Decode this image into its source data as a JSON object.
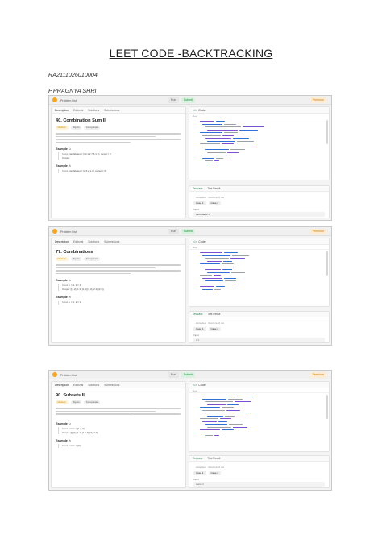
{
  "document": {
    "title": "LEET CODE -BACKTRACKING",
    "register_number": "RA2111026010004",
    "student_name": "P.PRAGNYA SHRI"
  },
  "screenshots": [
    {
      "problem_title": "40. Combination Sum II",
      "difficulty": "Medium",
      "tags": [
        "Topics",
        "Companies"
      ],
      "tabs": [
        "Description",
        "Editorial",
        "Solutions",
        "Submissions"
      ],
      "example_heading": "Example 1:",
      "example_input": "Input: candidates = [10,1,2,7,6,1,5], target = 8",
      "example_output": "Output:",
      "example2_heading": "Example 2:",
      "example2_input": "Input: candidates = [2,5,2,1,2], target = 5",
      "result": "Accepted",
      "runtime": "Runtime: 0 ms",
      "cases": [
        "Case 1",
        "Case 2"
      ],
      "input_label": "Input",
      "input_value": "candidates ="
    },
    {
      "problem_title": "77. Combinations",
      "difficulty": "Medium",
      "tags": [
        "Topics",
        "Companies"
      ],
      "tabs": [
        "Description",
        "Editorial",
        "Solutions",
        "Submissions"
      ],
      "example_heading": "Example 1:",
      "example_input": "Input: n = 4, k = 2",
      "example_output": "Output: [[1,2],[1,3],[1,4],[2,3],[2,4],[3,4]]",
      "example2_heading": "Example 2:",
      "example2_input": "Input: n = 1, k = 1",
      "result": "Accepted",
      "runtime": "Runtime: 0 ms",
      "cases": [
        "Case 1",
        "Case 2"
      ],
      "input_label": "Input",
      "input_value": "n ="
    },
    {
      "problem_title": "90. Subsets II",
      "difficulty": "Medium",
      "tags": [
        "Topics",
        "Companies"
      ],
      "tabs": [
        "Description",
        "Editorial",
        "Solutions",
        "Submissions"
      ],
      "example_heading": "Example 1:",
      "example_input": "Input: nums = [1,2,2]",
      "example_output": "Output: [[],[1],[1,2],[1,2,2],[2],[2,2]]",
      "example2_heading": "Example 2:",
      "example2_input": "Input: nums = [0]",
      "result": "Accepted",
      "runtime": "Runtime: 0 ms",
      "cases": [
        "Case 1",
        "Case 2"
      ],
      "input_label": "Input",
      "input_value": "nums ="
    }
  ],
  "toolbar": {
    "problem_list": "Problem List",
    "run": "Run",
    "submit": "Submit",
    "premium": "Premium"
  },
  "editor": {
    "header": "Code",
    "language": "C++",
    "auto": "Auto"
  },
  "result_tabs": {
    "testcase": "Testcase",
    "test_result": "Test Result"
  },
  "colors": {
    "accepted": "#2e8b57",
    "difficulty": "#c98a00",
    "keyword": "#7b4fd1",
    "identifier": "#2f6fd6",
    "plain": "#9aa0a6"
  }
}
